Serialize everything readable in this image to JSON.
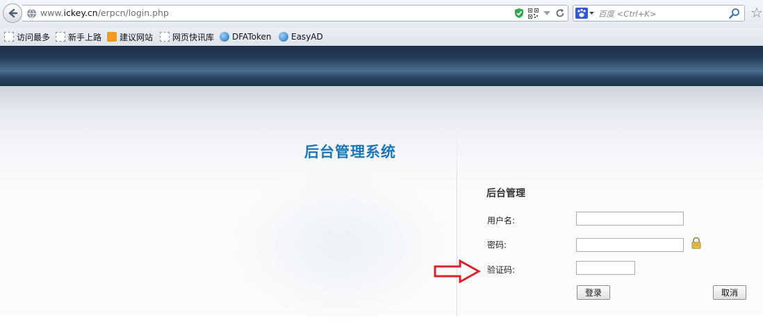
{
  "browser": {
    "url_prefix": "www.",
    "url_host": "ickey.cn",
    "url_path": "/erpcn/login.php",
    "search_engine": "百度",
    "search_placeholder": "<Ctrl+K>"
  },
  "bookmarks": [
    {
      "label": "访问最多",
      "icon": "page-icon"
    },
    {
      "label": "新手上路",
      "icon": "page-icon"
    },
    {
      "label": "建议网站",
      "icon": "orange-bookmark-icon"
    },
    {
      "label": "网页快讯库",
      "icon": "page-icon"
    },
    {
      "label": "DFAToken",
      "icon": "globe-icon"
    },
    {
      "label": "EasyAD",
      "icon": "globe-icon"
    }
  ],
  "page": {
    "system_title": "后台管理系统",
    "login": {
      "title": "后台管理",
      "username_label": "用户名:",
      "password_label": "密码:",
      "captcha_label": "验证码:",
      "login_button": "登录",
      "cancel_button": "取消"
    }
  },
  "colors": {
    "title_blue": "#1a76b8",
    "header_dark": "#1b3046",
    "annotation_red": "#d9232a"
  }
}
